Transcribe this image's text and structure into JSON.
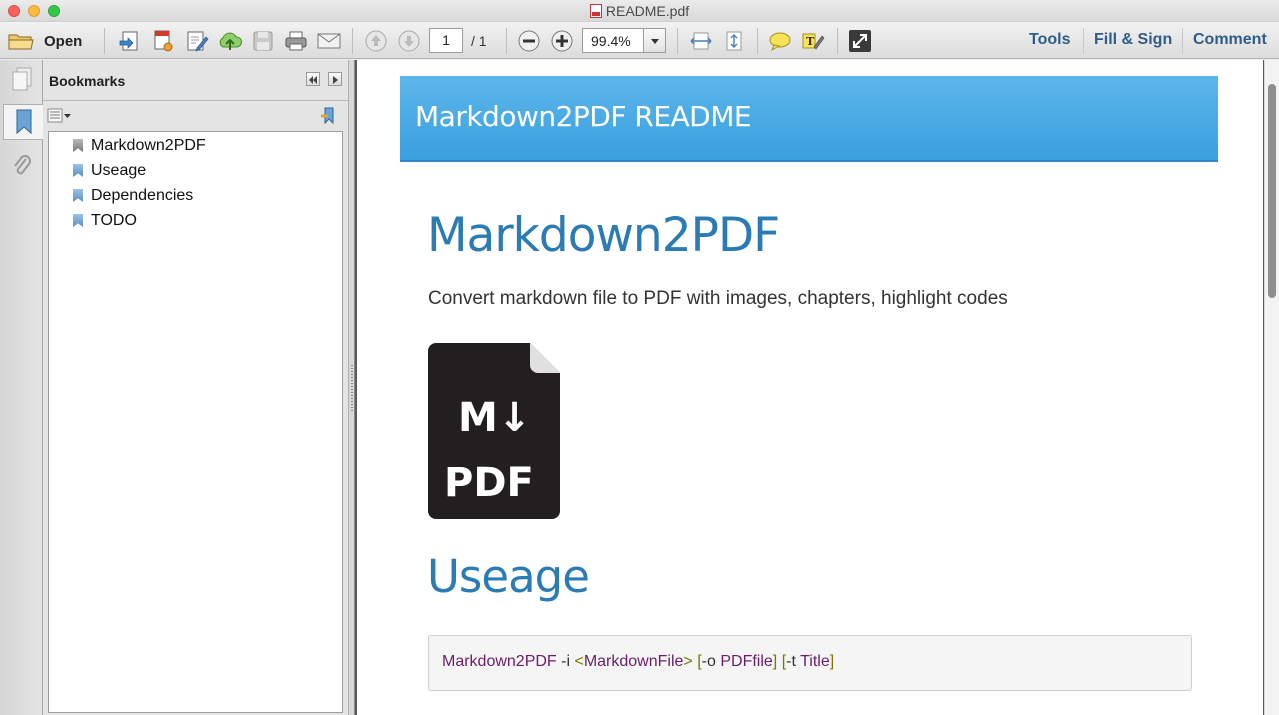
{
  "window": {
    "title": "README.pdf"
  },
  "toolbar": {
    "open_label": "Open",
    "page_current": "1",
    "page_total": "/ 1",
    "zoom": "99.4%",
    "tools_label": "Tools",
    "fill_sign_label": "Fill & Sign",
    "comment_label": "Comment"
  },
  "bookmarks": {
    "title": "Bookmarks",
    "items": [
      {
        "label": "Markdown2PDF"
      },
      {
        "label": "Useage"
      },
      {
        "label": "Dependencies"
      },
      {
        "label": "TODO"
      }
    ]
  },
  "document": {
    "banner": "Markdown2PDF README",
    "heading1": "Markdown2PDF",
    "description": "Convert markdown file to PDF with images, chapters, highlight codes",
    "logo_top": "M↓",
    "logo_bottom": "PDF",
    "heading2": "Useage",
    "code": {
      "cmd": "Markdown2PDF",
      "flag_i": " -i ",
      "lt": "<",
      "file": "MarkdownFile",
      "gt": ">",
      "sp1": " ",
      "lb1": "[",
      "flag_o": "-o ",
      "pdffile": "PDFfile",
      "rb1": "]",
      "sp2": " ",
      "lb2": "[",
      "flag_t": "-t ",
      "title": "Title",
      "rb2": "]"
    }
  },
  "colors": {
    "accent": "#2c7cb4",
    "banner": "#4aa9e4",
    "link": "#2f5d8a"
  }
}
